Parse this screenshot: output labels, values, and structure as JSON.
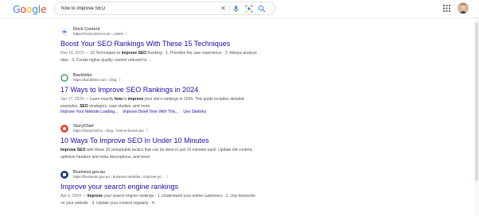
{
  "header": {
    "logo_letters": [
      "G",
      "o",
      "o",
      "g",
      "l",
      "e"
    ],
    "logo_colors": [
      "#4285f4",
      "#ea4335",
      "#fbbc05",
      "#4285f4",
      "#34a853",
      "#ea4335"
    ],
    "search_value": "how to improve SEO",
    "clear_icon": "close-icon",
    "mic_icon": "mic-icon",
    "lens_icon": "lens-icon",
    "search_icon": "search-icon",
    "apps_icon": "apps-grid-icon"
  },
  "results": [
    {
      "site_name": "Rock Content",
      "url": "https://rockcontent.com › Latest",
      "title": "Boost Your SEO Rankings With These 15 Techniques",
      "snippet_date": "Nov 16, 2022 —",
      "snippet_html": "15 Techniques to <b>improve SEO</b> Ranking · 1. Prioritize the user experience · 2. Always analyze data · 3. Create higher quality content relevant to ...",
      "favicon_color": "#4285f4",
      "favicon_icon": "rock-content-logo-icon"
    },
    {
      "site_name": "Backlinko",
      "url": "https://backlinko.com › blog",
      "title": "17 Ways to Improve SEO Rankings in 2024",
      "snippet_date": "Jan 17, 2024 —",
      "snippet_html": "Learn exactly <b>how</b> to <b>improve</b> your site's rankings in 2024. This guide includes detailed examples, <b>SEO</b> strategies, case studies, and more.",
      "sitelinks": [
        "Improve Your Website Loading...",
        "Improve Dwell Time With This...",
        "Use Sitelinks"
      ],
      "favicon_color": "#34a853",
      "favicon_icon": "backlinko-logo-icon"
    },
    {
      "site_name": "StoryChief",
      "url": "https://storychief.io › blog › how-to-boost-seo",
      "title": "10 Ways To Improve SEO In Under 10 Minutes",
      "snippet_date": "",
      "snippet_html": "<b>Improve SEO</b> with these 10 remarkable tactics that can be done in just 10 minutes each. Update old content, optimize headers and meta descriptions, and more.",
      "favicon_color": "#ea4335",
      "favicon_icon": "storychief-logo-icon"
    },
    {
      "site_name": "Business.gov.au",
      "url": "https://business.gov.au › business-website › improve-yo...",
      "title": "Improve your search engine rankings",
      "snippet_date": "Apr 6, 2024 —",
      "snippet_html": "<b>Improve</b> your search engine rankings · 1. Understand your online customers · 2. Use keywords on your website · 3. Update your content regularly · 4.",
      "favicon_color": "#1a3a6b",
      "favicon_icon": "business-gov-logo-icon"
    }
  ]
}
